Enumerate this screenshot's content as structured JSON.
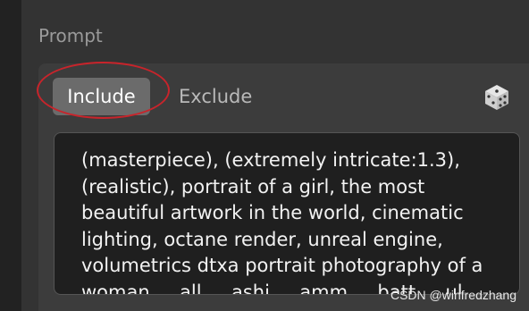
{
  "section": {
    "label": "Prompt"
  },
  "tabs": {
    "include": "Include",
    "exclude": "Exclude"
  },
  "icons": {
    "randomize": "dice-icon"
  },
  "prompt": {
    "text": "(masterpiece), (extremely intricate:1.3),\n(realistic), portrait of a girl, the most\nbeautiful artwork in the world, cinematic\nlighting, octane render, unreal engine,\nvolumetrics dtxa portrait photography of a\nwoman ... all ... ashi ... amm ... batt ... ul"
  },
  "watermark": {
    "text": "CSDN @winfredzhang"
  },
  "colors": {
    "annotation": "#c8242b",
    "active_tab": "#6b6b6b"
  }
}
